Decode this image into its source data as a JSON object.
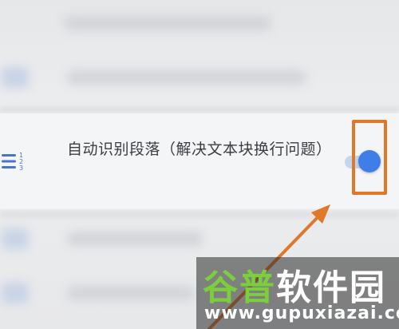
{
  "setting": {
    "label": "自动识别段落（解决文本块换行问题）",
    "icon": "paragraph-list-icon",
    "toggle_on": true
  },
  "watermark": {
    "text_prefix": "谷普",
    "text_suffix": "软件园",
    "url": "www.gupuxiazai.com"
  },
  "colors": {
    "accent": "#3f7ee8",
    "highlight": "#e0782a"
  }
}
